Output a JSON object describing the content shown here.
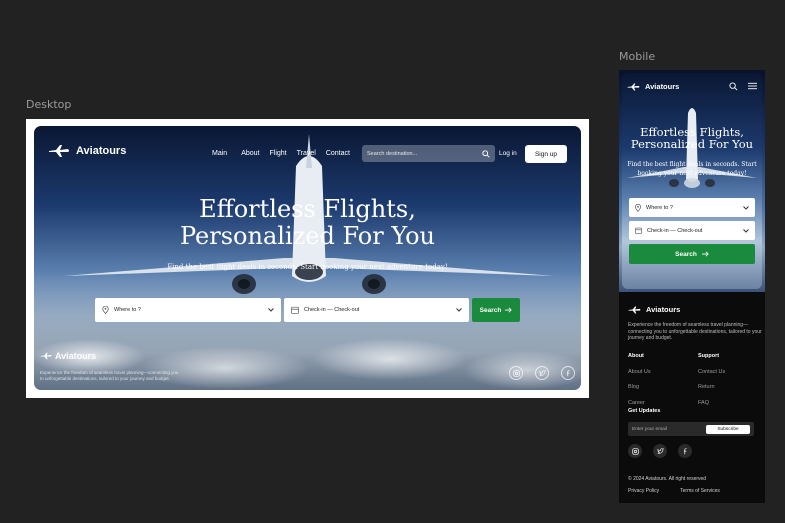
{
  "canvas": {
    "desktop_label": "Desktop",
    "mobile_label": "Mobile"
  },
  "brand": "Aviatours",
  "nav": {
    "links": [
      "Main",
      "About",
      "Flight",
      "Travel",
      "Contact"
    ],
    "search_placeholder": "Search destination...",
    "login": "Log in",
    "signup": "Sign up"
  },
  "hero": {
    "title_line1": "Effortless Flights,",
    "title_line2": "Personalized For You",
    "subtitle": "Find the best flight deals in seconds. Start booking your next adventure today!",
    "where_placeholder": "Where to ?",
    "dates_placeholder": "Check-in — Check-out",
    "search_button": "Search"
  },
  "footer": {
    "description": "Experience the freedom of seamless travel planning—connecting you to unforgettable destinations, tailored to your journey and budget.",
    "about_head": "About",
    "about_items": [
      "About Us",
      "Blog",
      "Career"
    ],
    "support_head": "Support",
    "support_items": [
      "Contact Us",
      "Return",
      "FAQ"
    ],
    "updates_head": "Get Updates",
    "email_placeholder": "Enter your email",
    "subscribe": "Subscribe",
    "copyright": "© 2024 Aviatours. All right reserved",
    "privacy": "Privacy Policy",
    "terms": "Terms of Services"
  },
  "colors": {
    "accent_green": "#1a8a3c",
    "background": "#222222"
  },
  "icons": [
    "plane-logo-icon",
    "search-icon",
    "location-pin-icon",
    "calendar-icon",
    "chevron-down-icon",
    "arrow-right-icon",
    "instagram-icon",
    "twitter-icon",
    "facebook-icon",
    "menu-icon"
  ]
}
